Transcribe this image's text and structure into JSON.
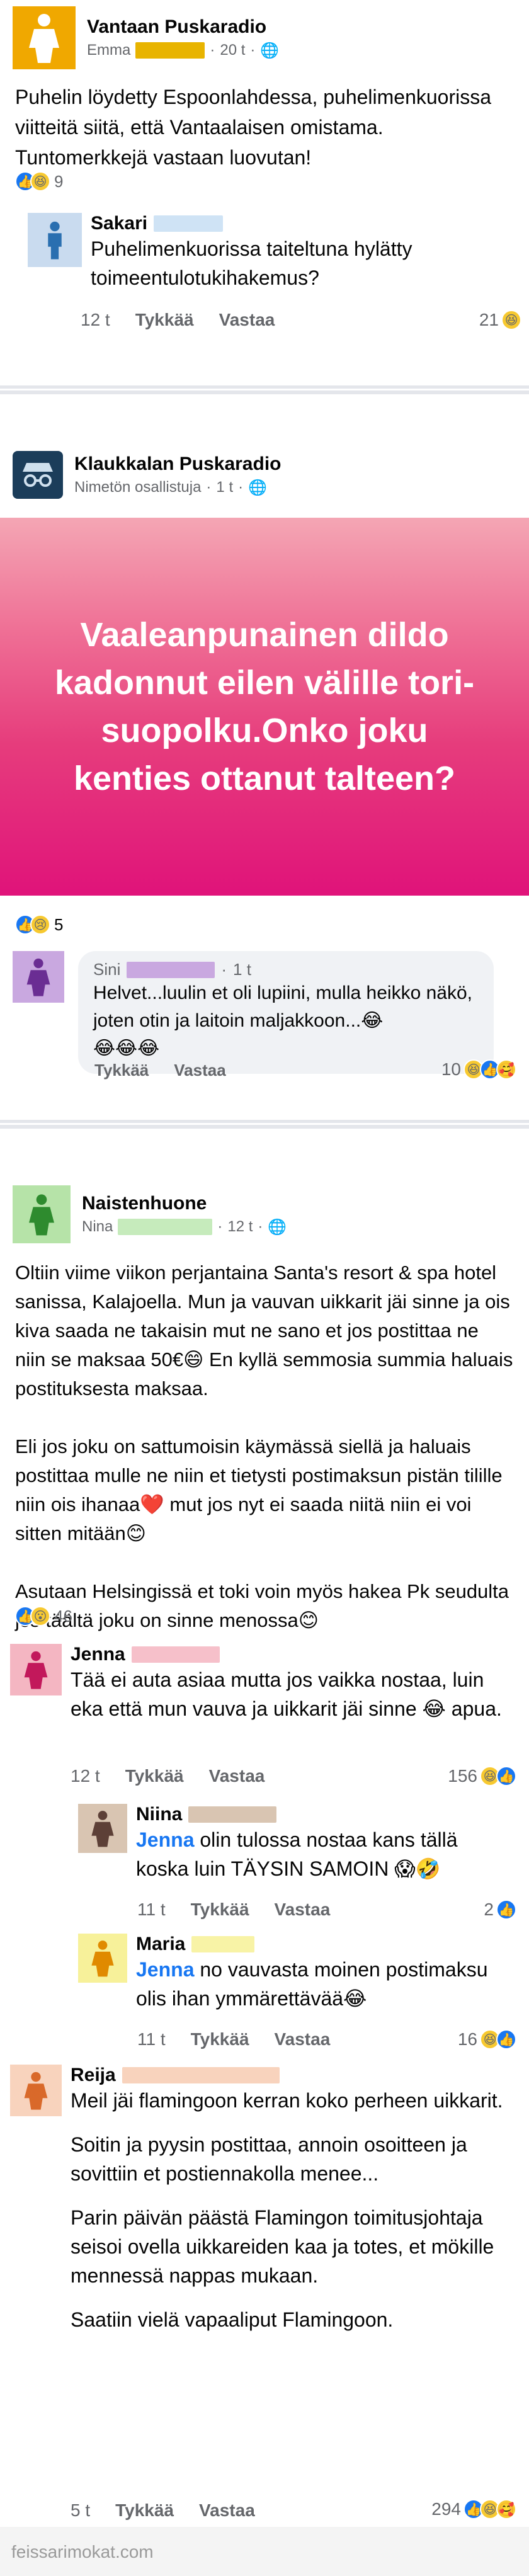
{
  "post1": {
    "group": "Vantaan Puskaradio",
    "author": "Emma",
    "time": "20 t",
    "globe": "globe-icon",
    "text": "Puhelin löydetty Espoonlahdessa, puhelimenkuorissa viitteitä siitä, että Vantaalaisen omistama. Tuntomerkkejä vastaan luovutan!",
    "reaction_count": "9",
    "comment": {
      "name": "Sakari",
      "text": "Puhelimenkuorissa taiteltuna hylätty toimeentulotukihakemus?",
      "time": "12 t",
      "like": "Tykkää",
      "reply": "Vastaa",
      "reactions": "21"
    }
  },
  "post2": {
    "group": "Klaukkalan Puskaradio",
    "author": "Nimetön osallistuja",
    "time": "1 t",
    "banner": "Vaaleanpunainen dildo kadonnut eilen välille tori-suopolku.Onko joku kenties ottanut talteen?",
    "reaction_count": "5",
    "comment": {
      "name": "Sini",
      "time": "1 t",
      "text": "Helvet...luulin et oli lupiini, mulla heikko näkö, joten otin ja laitoin maljakkoon...😂",
      "emojis": "😂😂😂",
      "like": "Tykkää",
      "reply": "Vastaa",
      "reactions": "10"
    }
  },
  "post3": {
    "group": "Naistenhuone",
    "author": "Nina",
    "time": "12 t",
    "para1": "Oltiin viime viikon perjantaina Santa's resort & spa hotel sanissa, Kalajoella. Mun ja vauvan uikkarit jäi sinne ja ois kiva saada ne takaisin mut ne sano et jos postittaa ne niin se maksaa 50€😄 En kyllä semmosia summia haluais postituksesta maksaa.",
    "para2": "Eli jos joku on sattumoisin käymässä siellä ja haluais postittaa mulle ne niin et tietysti postimaksun pistän tilille niin ois ihanaa❤️ mut jos nyt ei saada niitä niin ei voi sitten mitään😊",
    "para3": "Asutaan Helsingissä et toki voin myös hakea Pk seudulta jos täältä joku on sinne menossa😊",
    "reaction_count": "46",
    "comments": [
      {
        "name": "Jenna",
        "text": "Tää ei auta asiaa mutta jos vaikka nostaa, luin eka että mun vauva ja uikkarit jäi sinne 😂 apua.",
        "time": "12 t",
        "like": "Tykkää",
        "reply": "Vastaa",
        "reactions": "156"
      },
      {
        "name": "Niina",
        "mention": "Jenna",
        "text": " olin tulossa nostaa kans tällä koska luin TÄYSIN SAMOIN 😱🤣",
        "time": "11 t",
        "like": "Tykkää",
        "reply": "Vastaa",
        "reactions": "2"
      },
      {
        "name": "Maria",
        "mention": "Jenna",
        "text": " no vauvasta moinen postimaksu olis ihan ymmärettävää😂",
        "time": "11 t",
        "like": "Tykkää",
        "reply": "Vastaa",
        "reactions": "16"
      },
      {
        "name": "Reija",
        "para1": "Meil jäi flamingoon kerran koko perheen uikkarit.",
        "para2": "Soitin ja pyysin postittaa, annoin osoitteen ja sovittiin et postiennakolla menee...",
        "para3": "Parin päivän päästä Flamingon toimitusjohtaja seisoi ovella uikkareiden kaa ja totes, et mökille mennessä nappas mukaan.",
        "para4": "Saatiin vielä vapaaliput Flamingoon.",
        "time": "5 t",
        "like": "Tykkää",
        "reply": "Vastaa",
        "reactions": "294"
      }
    ]
  },
  "footer": "feissarimokat.com",
  "colors": {
    "fb_blue": "#1877f2",
    "separator": "#e4e6eb",
    "meta_gray": "#65676b",
    "banner_pink": "#e0137a"
  }
}
